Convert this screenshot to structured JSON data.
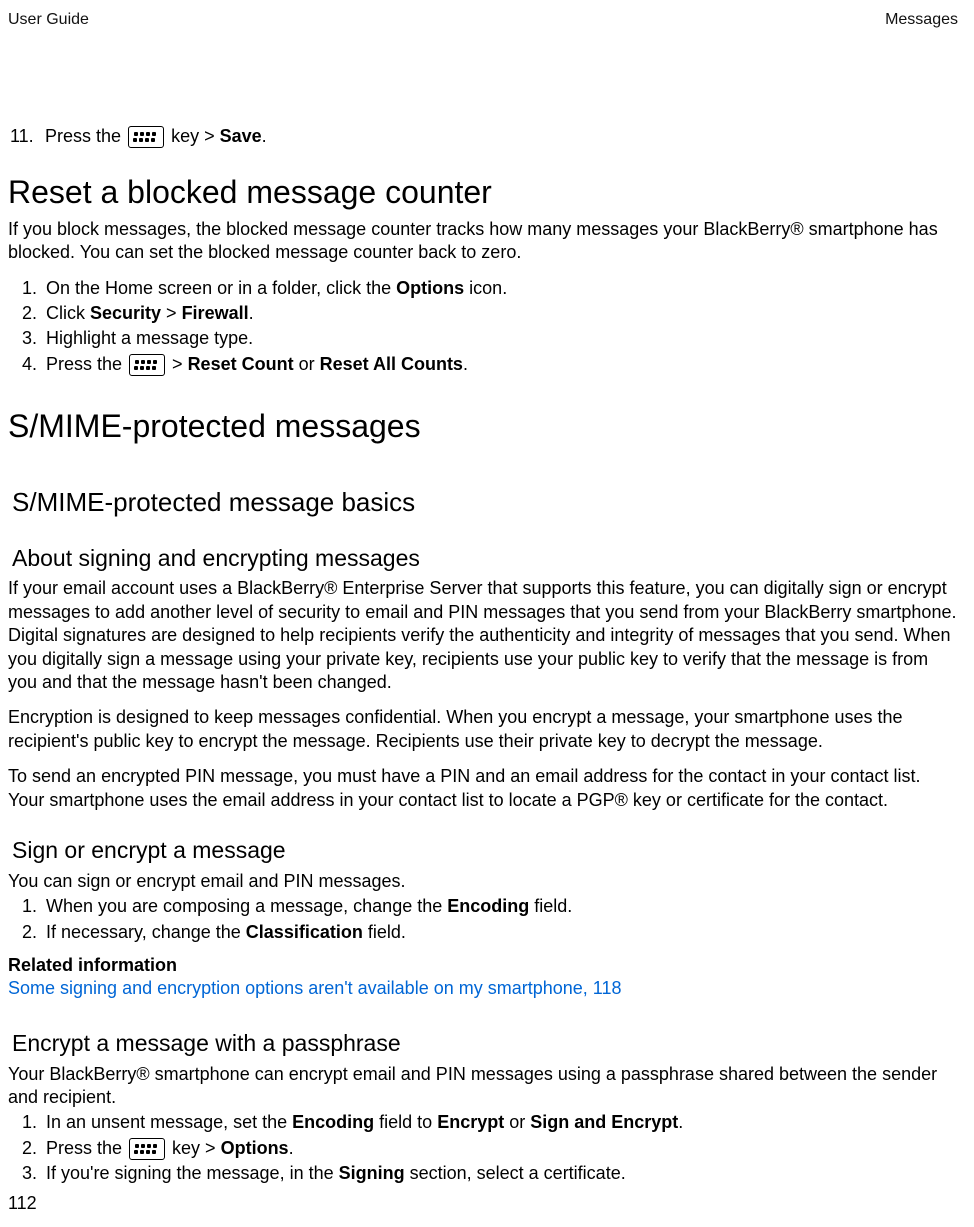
{
  "header": {
    "left": "User Guide",
    "right": "Messages"
  },
  "footer": {
    "page_number": "112"
  },
  "step11": {
    "pre": "Press the ",
    "post_key": " key > ",
    "bold_action": "Save",
    "tail": "."
  },
  "reset_counter": {
    "title": "Reset a blocked message counter",
    "intro": "If you block messages, the blocked message counter tracks how many messages your BlackBerry® smartphone has blocked. You can set the blocked message counter back to zero.",
    "steps": [
      {
        "pre": "On the Home screen or in a folder, click the ",
        "b1": "Options",
        "mid1": " icon."
      },
      {
        "pre": "Click ",
        "b1": "Security",
        "mid1": " > ",
        "b2": "Firewall",
        "mid2": "."
      },
      {
        "pre": "Highlight a message type."
      },
      {
        "pre": "Press the ",
        "has_key": true,
        "mid1": " > ",
        "b1": "Reset Count",
        "mid2": " or ",
        "b2": "Reset All Counts",
        "mid3": "."
      }
    ]
  },
  "smime": {
    "title": "S/MIME-protected messages",
    "basics_title": "S/MIME-protected message basics",
    "about": {
      "title": "About signing and encrypting messages",
      "p1": "If your email account uses a BlackBerry® Enterprise Server that supports this feature, you can digitally sign or encrypt messages to add another level of security to email and PIN messages that you send from your BlackBerry smartphone. Digital signatures are designed to help recipients verify the authenticity and integrity of messages that you send. When you digitally sign a message using your private key, recipients use your public key to verify that the message is from you and that the message hasn't been changed.",
      "p2": "Encryption is designed to keep messages confidential. When you encrypt a message, your smartphone uses the recipient's public key to encrypt the message. Recipients use their private key to decrypt the message.",
      "p3": "To send an encrypted PIN message, you must have a PIN and an email address for the contact in your contact list. Your smartphone uses the email address in your contact list to locate a PGP® key or certificate for the contact."
    },
    "sign_encrypt": {
      "title": "Sign or encrypt a message",
      "intro": "You can sign or encrypt email and PIN messages.",
      "steps": [
        {
          "pre": "When you are composing a message, change the ",
          "b1": "Encoding",
          "mid1": " field."
        },
        {
          "pre": "If necessary, change the ",
          "b1": "Classification",
          "mid1": " field."
        }
      ],
      "related_head": "Related information",
      "related_link": "Some signing and encryption options aren't available on my smartphone, 118"
    },
    "passphrase": {
      "title": "Encrypt a message with a passphrase",
      "intro": "Your BlackBerry® smartphone can encrypt email and PIN messages using a passphrase shared between the sender and recipient.",
      "steps": [
        {
          "pre": "In an unsent message, set the ",
          "b1": "Encoding",
          "mid1": " field to ",
          "b2": "Encrypt",
          "mid2": " or ",
          "b3": "Sign and Encrypt",
          "mid3": "."
        },
        {
          "pre": "Press the ",
          "has_key": true,
          "mid1": " key > ",
          "b1": "Options",
          "mid2": "."
        },
        {
          "pre": "If you're signing the message, in the ",
          "b1": "Signing",
          "mid1": " section, select a certificate."
        }
      ]
    }
  }
}
